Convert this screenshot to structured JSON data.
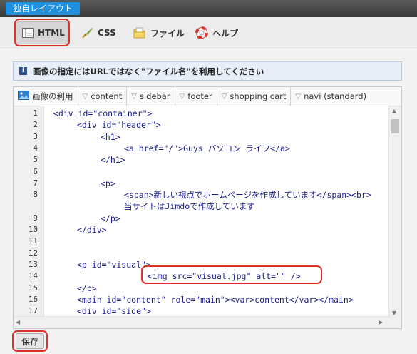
{
  "brand_tab": "独自レイアウト",
  "toolbar": {
    "buttons": [
      {
        "label": "HTML",
        "icon": "html-layout-icon",
        "active": true
      },
      {
        "label": "CSS",
        "icon": "brush-icon",
        "active": false
      },
      {
        "label": "ファイル",
        "icon": "folder-icon",
        "active": false
      },
      {
        "label": "ヘルプ",
        "icon": "lifebuoy-icon",
        "active": false
      }
    ]
  },
  "notice": "画像の指定にはURLではなく\"ファイル名\"を利用してください",
  "editor": {
    "tabs": [
      "画像の利用",
      "content",
      "sidebar",
      "footer",
      "shopping cart",
      "navi (standard)"
    ],
    "lines": [
      {
        "n": "1",
        "indent": 0,
        "text": "<div id=\"container\">"
      },
      {
        "n": "2",
        "indent": 1,
        "text": "<div id=\"header\">"
      },
      {
        "n": "3",
        "indent": 2,
        "text": "<h1>"
      },
      {
        "n": "4",
        "indent": 3,
        "text": "<a href=\"/\">Guys パソコン ライフ</a>"
      },
      {
        "n": "5",
        "indent": 2,
        "text": "</h1>"
      },
      {
        "n": "6",
        "indent": 0,
        "text": ""
      },
      {
        "n": "7",
        "indent": 2,
        "text": "<p>"
      },
      {
        "n": "8",
        "indent": 3,
        "text": "<span>新しい視点でホームページを作成しています</span><br>"
      },
      {
        "n": "",
        "indent": 3,
        "text": "当サイトはJimdoで作成しています"
      },
      {
        "n": "9",
        "indent": 2,
        "text": "</p>"
      },
      {
        "n": "10",
        "indent": 1,
        "text": "</div>"
      },
      {
        "n": "11",
        "indent": 0,
        "text": ""
      },
      {
        "n": "12",
        "indent": 0,
        "text": ""
      },
      {
        "n": "13",
        "indent": 1,
        "text": "<p id=\"visual\">"
      },
      {
        "n": "14",
        "indent": 4,
        "text": "<img src=\"visual.jpg\" alt=\"\" />"
      },
      {
        "n": "15",
        "indent": 1,
        "text": "</p>"
      },
      {
        "n": "16",
        "indent": 1,
        "text": "<main id=\"content\" role=\"main\"><var>content</var></main>"
      },
      {
        "n": "17",
        "indent": 1,
        "text": "<div id=\"side\">"
      }
    ]
  },
  "save_label": "保存",
  "colors": {
    "highlight": "#e0302a",
    "brand": "#1f8fe0",
    "code": "#1a1a8c"
  }
}
